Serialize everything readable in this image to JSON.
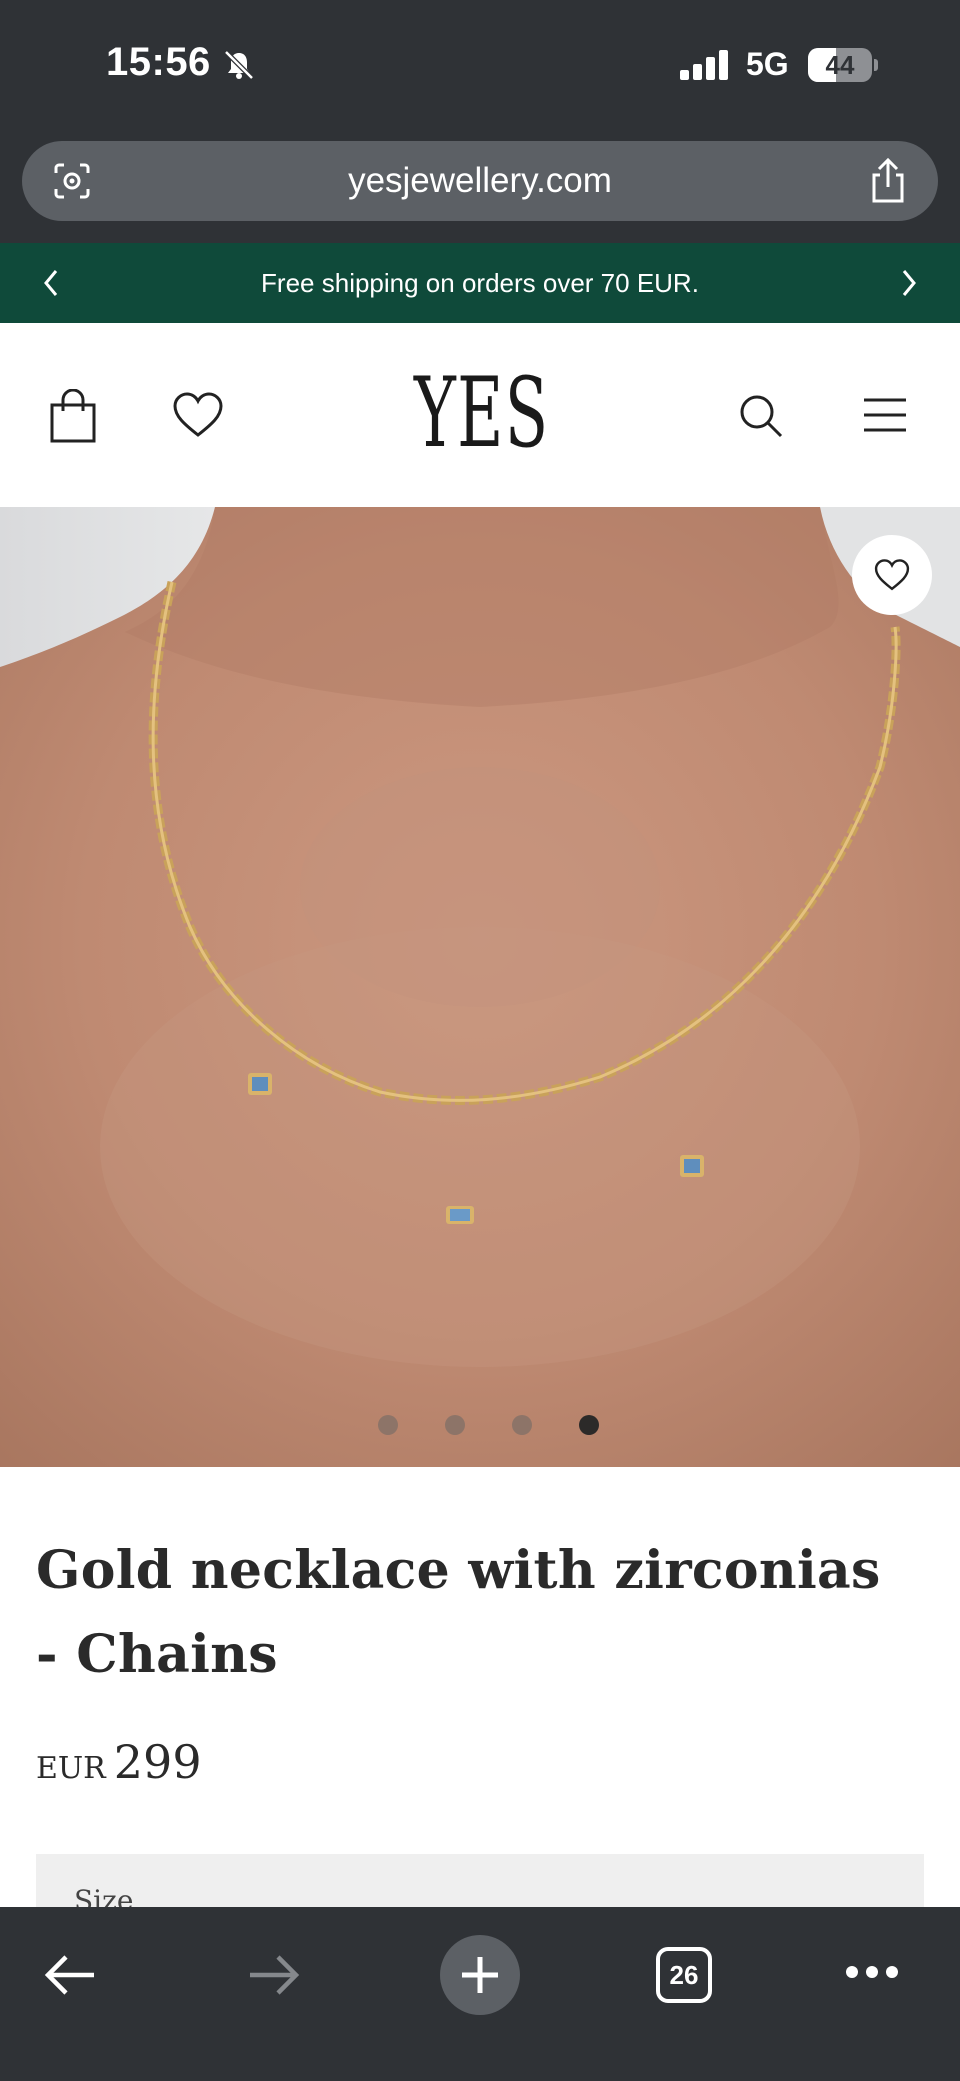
{
  "status_bar": {
    "time": "15:56",
    "network": "5G",
    "battery": "44",
    "battery_level": 0.44
  },
  "browser": {
    "url": "yesjewellery.com",
    "tab_count": "26"
  },
  "promo": {
    "text": "Free shipping on orders over 70 EUR."
  },
  "header": {
    "logo": "YES"
  },
  "gallery": {
    "image_count": 4,
    "active_index": 3
  },
  "product": {
    "title": "Gold necklace with zirconias - Chains",
    "currency": "EUR",
    "price": "299",
    "size_label": "Size"
  },
  "colors": {
    "promo_bg": "#0f4a3a",
    "browser_chrome": "#2f3236",
    "url_field": "#5c6065"
  }
}
